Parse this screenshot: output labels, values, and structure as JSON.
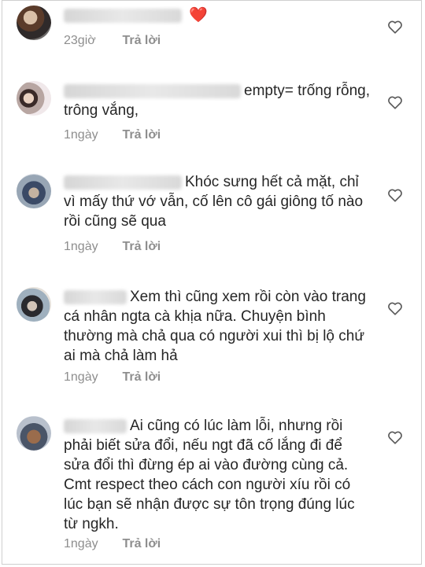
{
  "comments": [
    {
      "text": "",
      "emoji": "❤️",
      "time": "23giờ",
      "reply": "Trả lời"
    },
    {
      "text": "empty= trống rỗng, trông vắng,",
      "time": "1ngày",
      "reply": "Trả lời"
    },
    {
      "text": "Khóc sưng hết cả mặt, chỉ vì mấy thứ vớ vẫn, cố lên cô gái giông tố nào rồi cũng sẽ qua",
      "time": "1ngày",
      "reply": "Trả lời"
    },
    {
      "text": "Xem thì cũng xem rồi còn vào trang cá nhân ngta cà khịa nữa. Chuyện bình thường mà chả qua có người xui thì bị lộ chứ ai mà chả làm hả",
      "time": "1ngày",
      "reply": "Trả lời"
    },
    {
      "text": "Ai cũng có lúc làm lỗi, nhưng rồi phải biết sửa đổi, nếu ngt đã cố lắng đi để sửa đổi thì đừng ép ai vào đường cùng cả. Cmt respect theo cách con người xíu rồi có lúc bạn sẽ nhận được sự tôn trọng đúng lúc từ ngkh.",
      "time": "1ngày",
      "reply": "Trả lời"
    }
  ],
  "colors": {
    "text": "#262626",
    "meta": "#8e8e8e",
    "heart": "#e0245e"
  }
}
